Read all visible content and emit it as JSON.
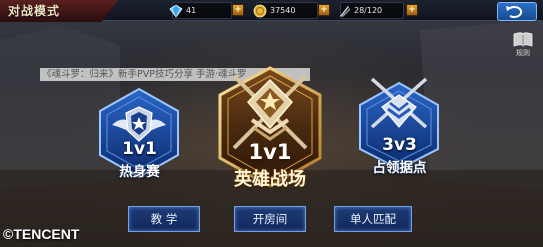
{
  "header": {
    "mode_title": "对战模式",
    "resources": [
      {
        "name": "diamond",
        "icon": "diamond-icon",
        "value": "41"
      },
      {
        "name": "gold",
        "icon": "gold-coin-icon",
        "value": "37540"
      },
      {
        "name": "stamina",
        "icon": "stamina-icon",
        "value": "28/120"
      }
    ]
  },
  "rules": {
    "label": "规则"
  },
  "banner": {
    "text": "《魂斗罗：归来》新手PVP技巧分享 手游·魂斗罗"
  },
  "modes": [
    {
      "id": "warmup",
      "format": "1v1",
      "name": "热身赛",
      "emblem": "shield-star-emblem-icon"
    },
    {
      "id": "hero-battle",
      "format": "1v1",
      "name": "英雄战场",
      "emblem": "gold-star-rank-emblem-icon"
    },
    {
      "id": "capture-point",
      "format": "3v3",
      "name": "占领据点",
      "emblem": "crossed-swords-emblem-icon"
    }
  ],
  "buttons": {
    "tutorial": "教 学",
    "create_room": "开房间",
    "solo_match": "单人匹配"
  },
  "watermark": "©TENCENT",
  "colors": {
    "blue_accent": "#2f7fe6",
    "gold_accent": "#d9a441",
    "title_red": "#5a1f1f"
  }
}
